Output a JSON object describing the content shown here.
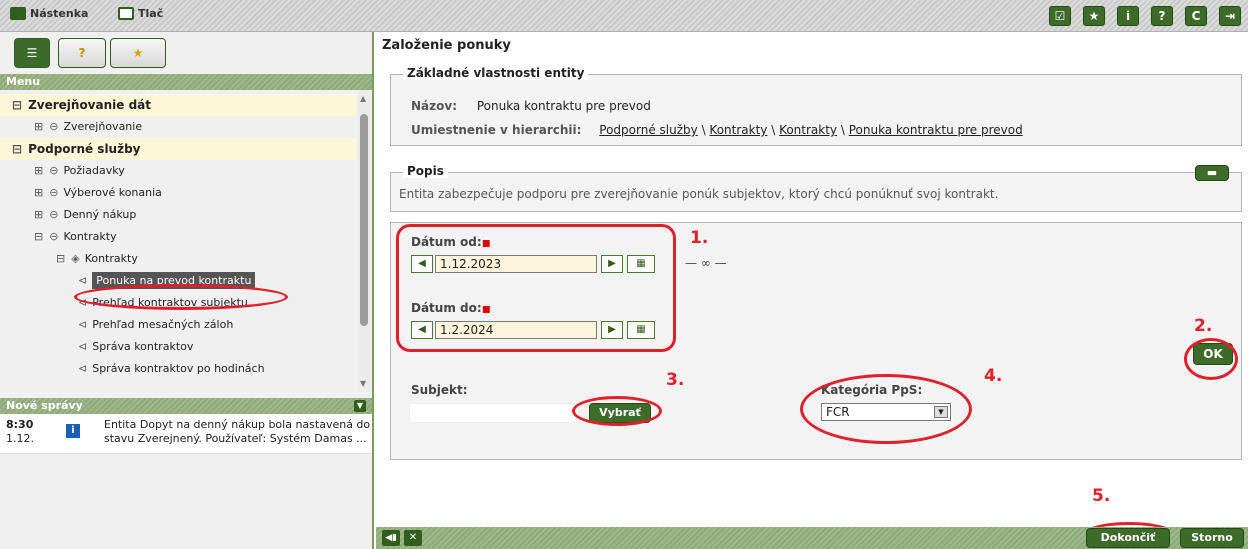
{
  "topbar": {
    "links": [
      {
        "label": "Nástenka",
        "icon": "home-icon"
      },
      {
        "label": "Tlač",
        "icon": "print-icon"
      }
    ],
    "buttons": [
      {
        "icon": "checklist-icon",
        "glyph": "☑"
      },
      {
        "icon": "star-icon",
        "glyph": "★"
      },
      {
        "icon": "info-icon",
        "glyph": "i"
      },
      {
        "icon": "help-icon",
        "glyph": "?"
      },
      {
        "icon": "refresh-icon",
        "glyph": "C"
      },
      {
        "icon": "exit-icon",
        "glyph": "⇥"
      }
    ]
  },
  "sidebar": {
    "menu_title": "Menu",
    "items": [
      {
        "label": "Zverejňovanie dát",
        "level": 0,
        "toggle": "−",
        "icon": "",
        "selected": false
      },
      {
        "label": "Zverejňovanie",
        "level": 1,
        "toggle": "+",
        "icon": "module-icon",
        "selected": false
      },
      {
        "label": "Podporné služby",
        "level": 0,
        "toggle": "−",
        "icon": "",
        "selected": false
      },
      {
        "label": "Požiadavky",
        "level": 1,
        "toggle": "+",
        "icon": "module-icon",
        "selected": false
      },
      {
        "label": "Výberové konania",
        "level": 1,
        "toggle": "+",
        "icon": "module-icon",
        "selected": false
      },
      {
        "label": "Denný nákup",
        "level": 1,
        "toggle": "+",
        "icon": "module-icon",
        "selected": false
      },
      {
        "label": "Kontrakty",
        "level": 1,
        "toggle": "−",
        "icon": "module-icon",
        "selected": false
      },
      {
        "label": "Kontrakty",
        "level": 2,
        "toggle": "−",
        "icon": "folder-icon",
        "selected": false
      },
      {
        "label": "Ponuka na prevod kontraktu",
        "level": 3,
        "toggle": "",
        "icon": "page-icon",
        "selected": true
      },
      {
        "label": "Prehľad kontraktov subjektu",
        "level": 3,
        "toggle": "",
        "icon": "page-icon",
        "selected": false
      },
      {
        "label": "Prehľad mesačných záloh",
        "level": 3,
        "toggle": "",
        "icon": "page-icon",
        "selected": false
      },
      {
        "label": "Správa kontraktov",
        "level": 3,
        "toggle": "",
        "icon": "page-icon",
        "selected": false
      },
      {
        "label": "Správa kontraktov po hodinách",
        "level": 3,
        "toggle": "",
        "icon": "page-icon",
        "selected": false
      }
    ],
    "news_title": "Nové správy",
    "news": [
      {
        "time": "8:30",
        "date": "1.12.",
        "text1": "Entita Dopyt na denný nákup bola nastavená do",
        "text2": "stavu Zverejnený. Používateľ: Systém Damas ..."
      }
    ]
  },
  "main": {
    "title": "Založenie ponuky",
    "props": {
      "legend": "Základné vlastnosti entity",
      "name_label": "Názov:",
      "name_value": "Ponuka kontraktu pre prevod",
      "location_label": "Umiestnenie v hierarchii:",
      "breadcrumb": [
        "Podporné služby",
        "Kontrakty",
        "Kontrakty",
        "Ponuka kontraktu pre prevod"
      ]
    },
    "popis": {
      "legend": "Popis",
      "text": "Entita zabezpečuje podporu pre zverejňovanie ponúk subjektov, ktorý chcú ponúknuť svoj kontrakt.",
      "collapse_glyph": "▬"
    },
    "form": {
      "date_from_label": "Dátum od:",
      "date_from_value": "1.12.2023",
      "date_to_label": "Dátum do:",
      "date_to_value": "1.2.2024",
      "required_mark": "▪",
      "link_glyph": "— ∞ —",
      "subject_label": "Subjekt:",
      "subject_value": "",
      "choose_button": "Vybrať",
      "category_label": "Kategória PpS:",
      "category_value": "FCR",
      "ok_button": "OK"
    },
    "annotations": [
      "1.",
      "2.",
      "3.",
      "4.",
      "5."
    ],
    "footer": {
      "finish": "Dokončiť",
      "cancel": "Storno"
    }
  }
}
